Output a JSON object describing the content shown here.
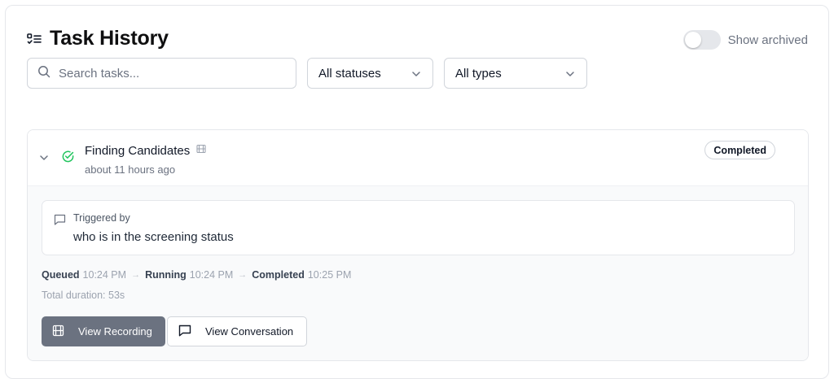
{
  "header": {
    "title": "Task History",
    "title_icon": "list-todo-icon",
    "show_archived_label": "Show archived",
    "show_archived_on": false
  },
  "filters": {
    "search_placeholder": "Search tasks...",
    "search_value": "",
    "status_selected": "All statuses",
    "type_selected": "All types"
  },
  "task": {
    "name": "Finding Candidates",
    "relative_time": "about 11 hours ago",
    "status": "Completed",
    "status_icon": "check-circle-icon",
    "trigger_label": "Triggered by",
    "trigger_text": "who is in the screening status",
    "timeline": [
      {
        "label": "Queued",
        "time": "10:24 PM"
      },
      {
        "label": "Running",
        "time": "10:24 PM"
      },
      {
        "label": "Completed",
        "time": "10:25 PM"
      }
    ],
    "duration": "Total duration: 53s",
    "actions": {
      "view_recording": "View Recording",
      "view_conversation": "View Conversation"
    }
  },
  "colors": {
    "success": "#22c55e",
    "primary_button": "#6b7280",
    "border": "#e5e7eb"
  }
}
